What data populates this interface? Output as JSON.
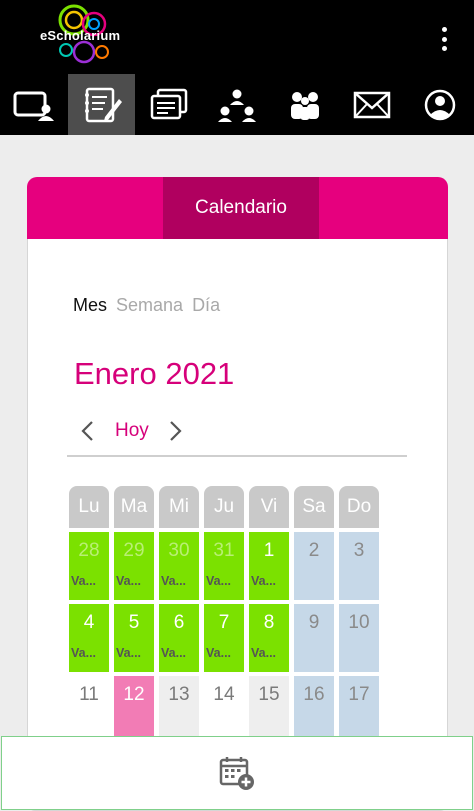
{
  "header": {
    "logo_text": "eScholarium",
    "nav": [
      {
        "name": "nav-usuario",
        "icon": "user-screen-icon",
        "active": false
      },
      {
        "name": "nav-agenda",
        "icon": "notebook-edit-icon",
        "active": true
      },
      {
        "name": "nav-documentos",
        "icon": "documents-icon",
        "active": false
      },
      {
        "name": "nav-grupos",
        "icon": "hierarchy-icon",
        "active": false
      },
      {
        "name": "nav-contactos",
        "icon": "people-icon",
        "active": false
      },
      {
        "name": "nav-mensajes",
        "icon": "envelope-icon",
        "active": false
      },
      {
        "name": "nav-perfil",
        "icon": "profile-icon",
        "active": false
      }
    ]
  },
  "tab": {
    "label": "Calendario"
  },
  "views": {
    "month": "Mes",
    "week": "Semana",
    "day": "Día"
  },
  "calendar": {
    "title": "Enero 2021",
    "today_label": "Hoy",
    "weekdays": [
      "Lu",
      "Ma",
      "Mi",
      "Ju",
      "Vi",
      "Sa",
      "Do"
    ],
    "weeks": [
      [
        {
          "num": "28",
          "style": "green faded",
          "event": "Va..."
        },
        {
          "num": "29",
          "style": "green faded",
          "event": "Va..."
        },
        {
          "num": "30",
          "style": "green faded",
          "event": "Va..."
        },
        {
          "num": "31",
          "style": "green faded",
          "event": "Va..."
        },
        {
          "num": "1",
          "style": "green",
          "event": "Va..."
        },
        {
          "num": "2",
          "style": "blue",
          "event": ""
        },
        {
          "num": "3",
          "style": "blue",
          "event": ""
        }
      ],
      [
        {
          "num": "4",
          "style": "green",
          "event": "Va..."
        },
        {
          "num": "5",
          "style": "green",
          "event": "Va..."
        },
        {
          "num": "6",
          "style": "green",
          "event": "Va..."
        },
        {
          "num": "7",
          "style": "green",
          "event": "Va..."
        },
        {
          "num": "8",
          "style": "green",
          "event": "Va..."
        },
        {
          "num": "9",
          "style": "blue",
          "event": ""
        },
        {
          "num": "10",
          "style": "blue",
          "event": ""
        }
      ],
      [
        {
          "num": "11",
          "style": "plain",
          "event": ""
        },
        {
          "num": "12",
          "style": "pink",
          "event": ""
        },
        {
          "num": "13",
          "style": "grey",
          "event": ""
        },
        {
          "num": "14",
          "style": "plain",
          "event": ""
        },
        {
          "num": "15",
          "style": "grey",
          "event": ""
        },
        {
          "num": "16",
          "style": "blue",
          "event": ""
        },
        {
          "num": "17",
          "style": "blue",
          "event": ""
        }
      ]
    ]
  },
  "footer": {
    "icon": "calendar-add-icon"
  }
}
